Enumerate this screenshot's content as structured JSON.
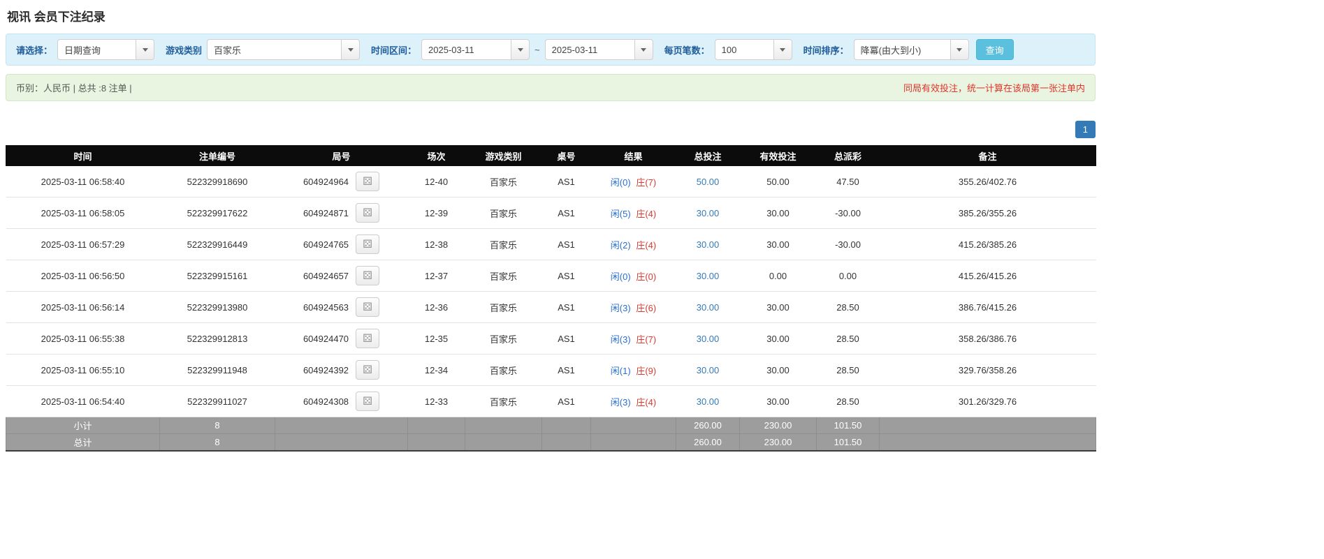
{
  "page": {
    "title": "视讯 会员下注纪录"
  },
  "icons": {
    "dice": "⚄"
  },
  "filters": {
    "select_label": "请选择：",
    "select_value": "日期查询",
    "game_label": "游戏类别",
    "game_value": "百家乐",
    "range_label": "时间区间：",
    "date_from": "2025-03-11",
    "tilde": "~",
    "date_to": "2025-03-11",
    "per_page_label": "每页笔数：",
    "per_page_value": "100",
    "sort_label": "时间排序：",
    "sort_value": "降冪(由大到小)",
    "query_button": "查询"
  },
  "summary": {
    "left": "币别：人民币 | 总共 :8 注单 |",
    "right": "同局有效投注，统一计算在该局第一张注单内"
  },
  "pagination": {
    "page": "1"
  },
  "table": {
    "headers": [
      "时间",
      "注单编号",
      "局号",
      "场次",
      "游戏类别",
      "桌号",
      "结果",
      "总投注",
      "有效投注",
      "总派彩",
      "备注"
    ],
    "rows": [
      {
        "time": "2025-03-11 06:58:40",
        "bet_id": "522329918690",
        "round_id": "604924964",
        "session": "12-40",
        "game": "百家乐",
        "table_no": "AS1",
        "player": "闲(0)",
        "banker": "庄(7)",
        "total_bet": "50.00",
        "valid_bet": "50.00",
        "payout": "47.50",
        "payout_neg": false,
        "remark": "355.26/402.76"
      },
      {
        "time": "2025-03-11 06:58:05",
        "bet_id": "522329917622",
        "round_id": "604924871",
        "session": "12-39",
        "game": "百家乐",
        "table_no": "AS1",
        "player": "闲(5)",
        "banker": "庄(4)",
        "total_bet": "30.00",
        "valid_bet": "30.00",
        "payout": "-30.00",
        "payout_neg": true,
        "remark": "385.26/355.26"
      },
      {
        "time": "2025-03-11 06:57:29",
        "bet_id": "522329916449",
        "round_id": "604924765",
        "session": "12-38",
        "game": "百家乐",
        "table_no": "AS1",
        "player": "闲(2)",
        "banker": "庄(4)",
        "total_bet": "30.00",
        "valid_bet": "30.00",
        "payout": "-30.00",
        "payout_neg": true,
        "remark": "415.26/385.26"
      },
      {
        "time": "2025-03-11 06:56:50",
        "bet_id": "522329915161",
        "round_id": "604924657",
        "session": "12-37",
        "game": "百家乐",
        "table_no": "AS1",
        "player": "闲(0)",
        "banker": "庄(0)",
        "total_bet": "30.00",
        "valid_bet": "0.00",
        "payout": "0.00",
        "payout_neg": false,
        "remark": "415.26/415.26"
      },
      {
        "time": "2025-03-11 06:56:14",
        "bet_id": "522329913980",
        "round_id": "604924563",
        "session": "12-36",
        "game": "百家乐",
        "table_no": "AS1",
        "player": "闲(3)",
        "banker": "庄(6)",
        "total_bet": "30.00",
        "valid_bet": "30.00",
        "payout": "28.50",
        "payout_neg": false,
        "remark": "386.76/415.26"
      },
      {
        "time": "2025-03-11 06:55:38",
        "bet_id": "522329912813",
        "round_id": "604924470",
        "session": "12-35",
        "game": "百家乐",
        "table_no": "AS1",
        "player": "闲(3)",
        "banker": "庄(7)",
        "total_bet": "30.00",
        "valid_bet": "30.00",
        "payout": "28.50",
        "payout_neg": false,
        "remark": "358.26/386.76"
      },
      {
        "time": "2025-03-11 06:55:10",
        "bet_id": "522329911948",
        "round_id": "604924392",
        "session": "12-34",
        "game": "百家乐",
        "table_no": "AS1",
        "player": "闲(1)",
        "banker": "庄(9)",
        "total_bet": "30.00",
        "valid_bet": "30.00",
        "payout": "28.50",
        "payout_neg": false,
        "remark": "329.76/358.26"
      },
      {
        "time": "2025-03-11 06:54:40",
        "bet_id": "522329911027",
        "round_id": "604924308",
        "session": "12-33",
        "game": "百家乐",
        "table_no": "AS1",
        "player": "闲(3)",
        "banker": "庄(4)",
        "total_bet": "30.00",
        "valid_bet": "30.00",
        "payout": "28.50",
        "payout_neg": false,
        "remark": "301.26/329.76"
      }
    ],
    "subtotal": {
      "label": "小计",
      "count": "8",
      "total_bet": "260.00",
      "valid_bet": "230.00",
      "payout": "101.50"
    },
    "grand_total": {
      "label": "总计",
      "count": "8",
      "total_bet": "260.00",
      "valid_bet": "230.00",
      "payout": "101.50"
    }
  }
}
